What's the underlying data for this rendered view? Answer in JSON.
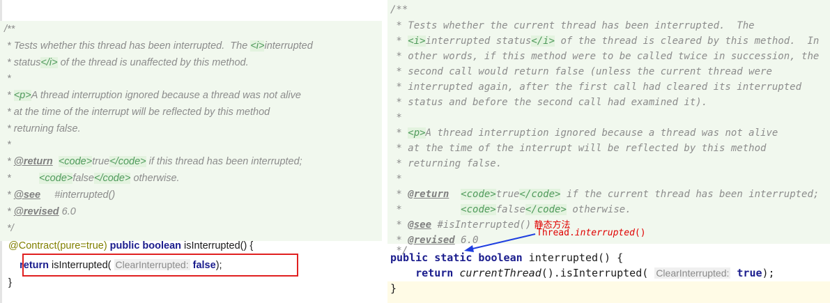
{
  "left": {
    "lines": {
      "l1": "/**",
      "l2a": " * Tests whether this thread has been interrupted.  The ",
      "l2b": "<i>",
      "l2c": "interrupted",
      "l3a": " * status",
      "l3b": "</i>",
      "l3c": " of the thread is unaffected by this method.",
      "l4": " *",
      "l5a": " * ",
      "l5b": "<p>",
      "l5c": "A thread interruption ignored because a thread was not alive",
      "l6": " * at the time of the interrupt will be reflected by this method",
      "l7": " * returning false.",
      "l8": " *",
      "l9a": " * ",
      "l9b": "@return",
      "l9c": "  ",
      "l9d": "<code>",
      "l9e": "true",
      "l9f": "</code>",
      "l9g": " if this thread has been interrupted;",
      "l10a": " *          ",
      "l10b": "<code>",
      "l10c": "false",
      "l10d": "</code>",
      "l10e": " otherwise.",
      "l11a": " * ",
      "l11b": "@see",
      "l11c": "     #interrupted()",
      "l12a": " * ",
      "l12b": "@revised",
      "l12c": " 6.0",
      "l13": " */",
      "l14a": "@Contract(pure=true)",
      "l14b": " public boolean",
      "l14c": " isInterrupted() {",
      "l15a": "    ",
      "l15b": "return",
      "l15c": " isInterrupted( ",
      "l15d": "ClearInterrupted:",
      "l15e": " false",
      "l15f": ");",
      "l16": "}"
    }
  },
  "right": {
    "lines": {
      "r1": "/**",
      "r2": " * Tests whether the current thread has been interrupted.  The",
      "r3a": " * ",
      "r3b": "<i>",
      "r3c": "interrupted status",
      "r3d": "</i>",
      "r3e": " of the thread is cleared by this method.  In",
      "r4": " * other words, if this method were to be called twice in succession, the",
      "r5": " * second call would return false (unless the current thread were",
      "r6": " * interrupted again, after the first call had cleared its interrupted",
      "r7": " * status and before the second call had examined it).",
      "r8": " *",
      "r9a": " * ",
      "r9b": "<p>",
      "r9c": "A thread interruption ignored because a thread was not alive",
      "r10": " * at the time of the interrupt will be reflected by this method",
      "r11": " * returning false.",
      "r12": " *",
      "r13a": " * ",
      "r13b": "@return",
      "r13c": "  ",
      "r13d": "<code>",
      "r13e": "true",
      "r13f": "</code>",
      "r13g": " if the current thread has been interrupted;",
      "r14a": " *          ",
      "r14b": "<code>",
      "r14c": "false",
      "r14d": "</code>",
      "r14e": " otherwise.",
      "r15a": " * ",
      "r15b": "@see",
      "r15c": " #isInterrupted()",
      "r15d": " 静态方法",
      "r16a": " * ",
      "r16b": "@revised",
      "r16c": " 6.0",
      "r16d": "Thread.",
      "r16e": "interrupted",
      "r16f": "()",
      "r17": " */",
      "r18a": "public static boolean",
      "r18b": " interrupted() {",
      "r19a": "    ",
      "r19b": "return",
      "r19c": " currentThread",
      "r19d": "().isInterrupted( ",
      "r19e": "ClearInterrupted:",
      "r19f": " true",
      "r19g": ");",
      "r20": "}"
    }
  },
  "colors": {
    "doc_background": "#f1f8ee",
    "keyword": "#1a1c8d",
    "annotation_red": "#e00000",
    "arrow": "#1f3fe0"
  }
}
